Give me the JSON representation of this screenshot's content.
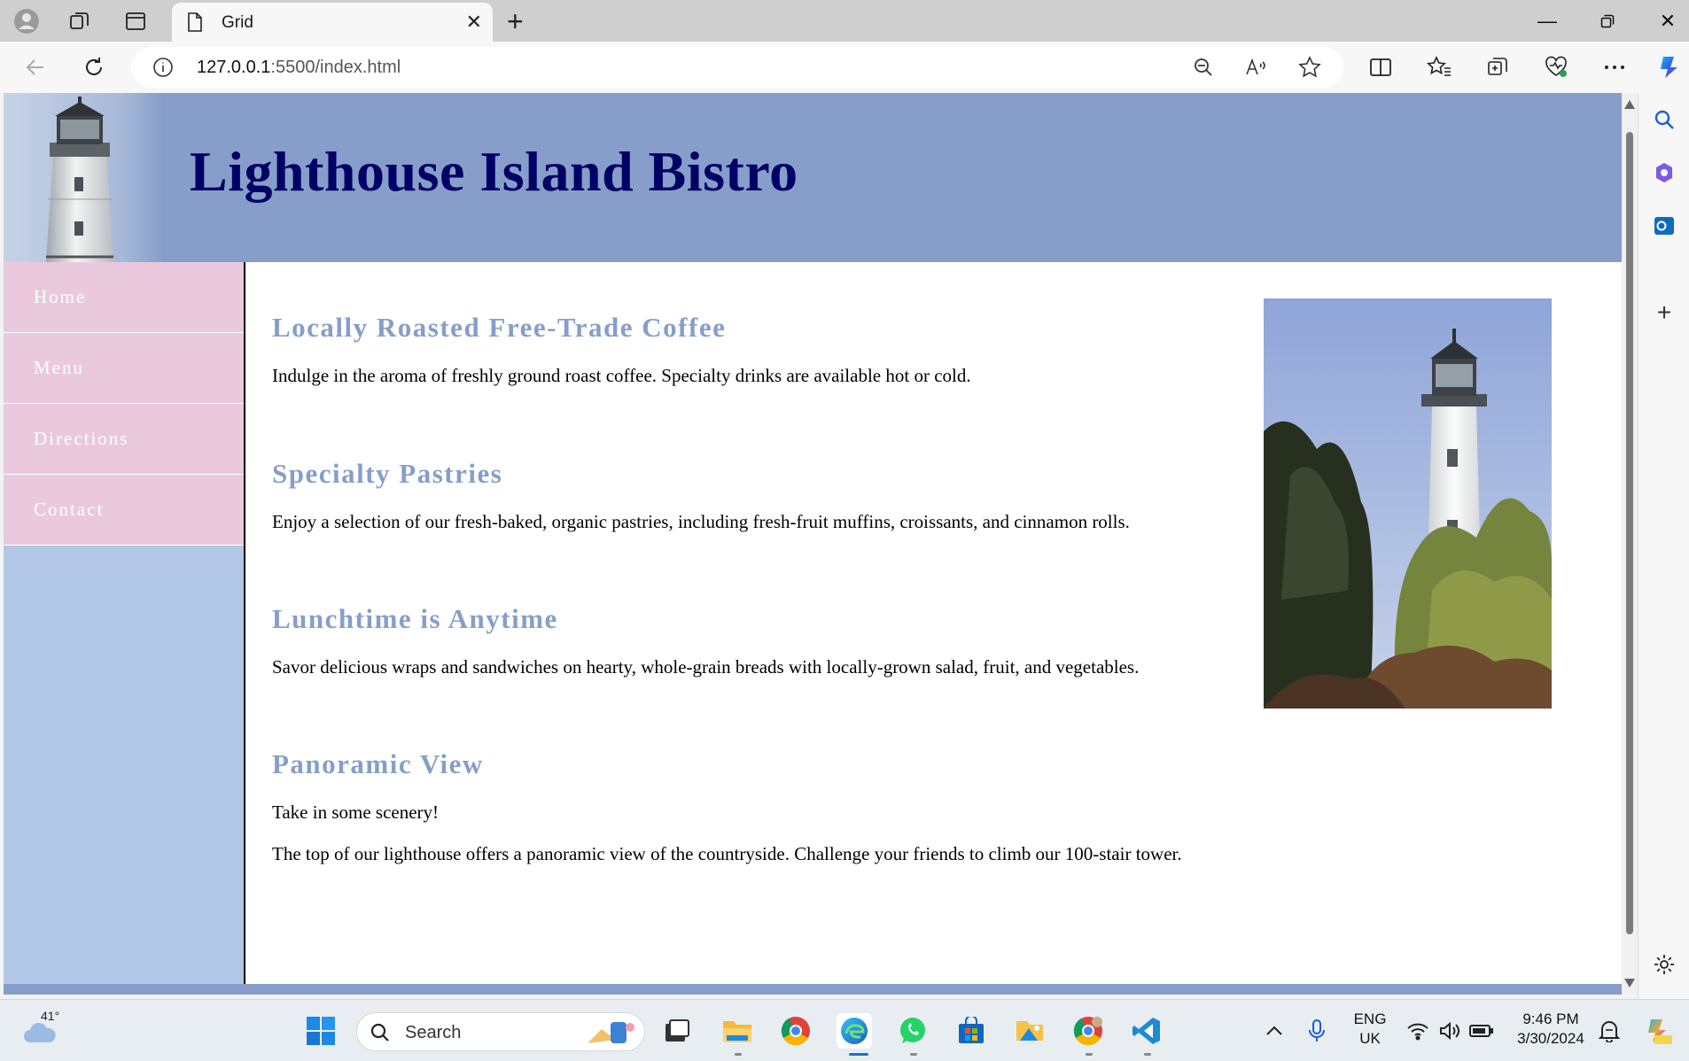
{
  "browser": {
    "tab_title": "Grid",
    "url_host": "127.0.0.1",
    "url_path": ":5500/index.html"
  },
  "site": {
    "title": "Lighthouse Island Bistro",
    "nav": [
      "Home",
      "Menu",
      "Directions",
      "Contact"
    ],
    "sections": [
      {
        "heading": "Locally Roasted Free-Trade Coffee",
        "paragraphs": [
          "Indulge in the aroma of freshly ground roast coffee. Specialty drinks are available hot or cold."
        ]
      },
      {
        "heading": "Specialty Pastries",
        "paragraphs": [
          "Enjoy a selection of our fresh-baked, organic pastries, including fresh-fruit muffins, croissants, and cinnamon rolls."
        ]
      },
      {
        "heading": "Lunchtime is Anytime",
        "paragraphs": [
          "Savor delicious wraps and sandwiches on hearty, whole-grain breads with locally-grown salad, fruit, and vegetables."
        ]
      },
      {
        "heading": "Panoramic View",
        "paragraphs": [
          "Take in some scenery!",
          "The top of our lighthouse offers a panoramic view of the countryside. Challenge your friends to climb our 100-stair tower."
        ]
      }
    ],
    "colors": {
      "header_bg": "#869ec9",
      "title": "#000066",
      "nav_item_bg": "#eac9dc",
      "nav_bg": "#b3c7e6"
    }
  },
  "taskbar": {
    "weather_temp": "41°",
    "search_label": "Search",
    "lang_line1": "ENG",
    "lang_line2": "UK",
    "time": "9:46 PM",
    "date": "3/30/2024"
  }
}
